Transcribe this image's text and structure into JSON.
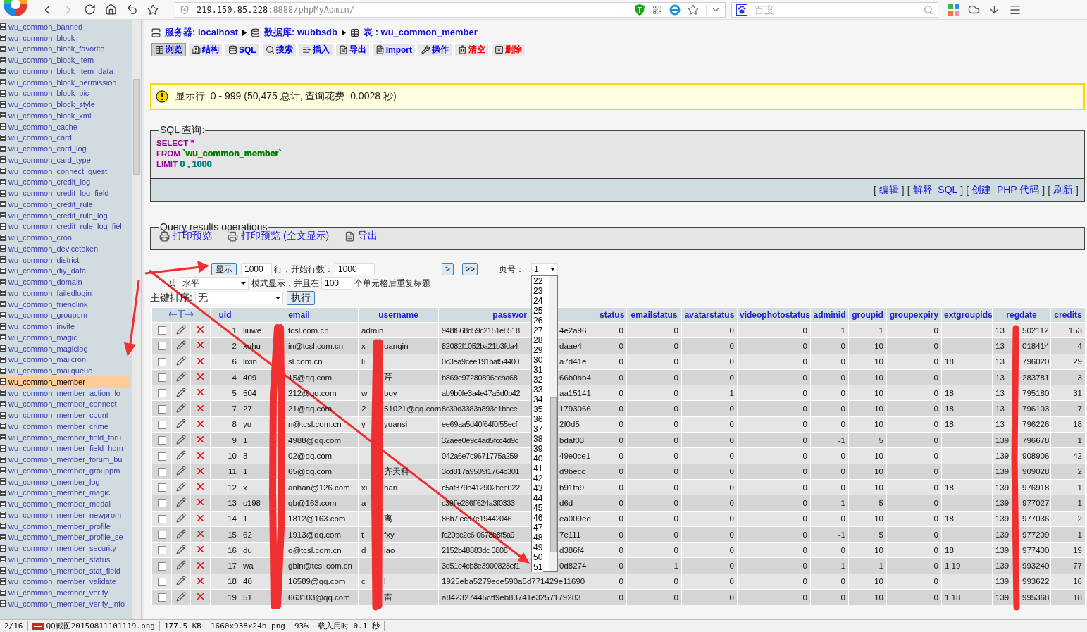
{
  "browser": {
    "address": {
      "host": "219.150.85.228",
      "rest": ":8888/phpMyAdmin/"
    },
    "search": {
      "placeholder": "百度"
    }
  },
  "sidebar": {
    "items": [
      {
        "label": "wu_common_banned",
        "selected": false
      },
      {
        "label": "wu_common_block",
        "selected": false
      },
      {
        "label": "wu_common_block_favorite",
        "selected": false
      },
      {
        "label": "wu_common_block_item",
        "selected": false
      },
      {
        "label": "wu_common_block_item_data",
        "selected": false
      },
      {
        "label": "wu_common_block_permission",
        "selected": false
      },
      {
        "label": "wu_common_block_pic",
        "selected": false
      },
      {
        "label": "wu_common_block_style",
        "selected": false
      },
      {
        "label": "wu_common_block_xml",
        "selected": false
      },
      {
        "label": "wu_common_cache",
        "selected": false
      },
      {
        "label": "wu_common_card",
        "selected": false
      },
      {
        "label": "wu_common_card_log",
        "selected": false
      },
      {
        "label": "wu_common_card_type",
        "selected": false
      },
      {
        "label": "wu_common_connect_guest",
        "selected": false
      },
      {
        "label": "wu_common_credit_log",
        "selected": false
      },
      {
        "label": "wu_common_credit_log_field",
        "selected": false
      },
      {
        "label": "wu_common_credit_rule",
        "selected": false
      },
      {
        "label": "wu_common_credit_rule_log",
        "selected": false
      },
      {
        "label": "wu_common_credit_rule_log_fiel",
        "selected": false
      },
      {
        "label": "wu_common_cron",
        "selected": false
      },
      {
        "label": "wu_common_devicetoken",
        "selected": false
      },
      {
        "label": "wu_common_district",
        "selected": false
      },
      {
        "label": "wu_common_diy_data",
        "selected": false
      },
      {
        "label": "wu_common_domain",
        "selected": false
      },
      {
        "label": "wu_common_failedlogin",
        "selected": false
      },
      {
        "label": "wu_common_friendlink",
        "selected": false
      },
      {
        "label": "wu_common_grouppm",
        "selected": false
      },
      {
        "label": "wu_common_invite",
        "selected": false
      },
      {
        "label": "wu_common_magic",
        "selected": false
      },
      {
        "label": "wu_common_magiclog",
        "selected": false
      },
      {
        "label": "wu_common_mailcron",
        "selected": false
      },
      {
        "label": "wu_common_mailqueue",
        "selected": false
      },
      {
        "label": "wu_common_member",
        "selected": true
      },
      {
        "label": "wu_common_member_action_lo",
        "selected": false
      },
      {
        "label": "wu_common_member_connect",
        "selected": false
      },
      {
        "label": "wu_common_member_count",
        "selected": false
      },
      {
        "label": "wu_common_member_crime",
        "selected": false
      },
      {
        "label": "wu_common_member_field_foru",
        "selected": false
      },
      {
        "label": "wu_common_member_field_hom",
        "selected": false
      },
      {
        "label": "wu_common_member_forum_bu",
        "selected": false
      },
      {
        "label": "wu_common_member_grouppm",
        "selected": false
      },
      {
        "label": "wu_common_member_log",
        "selected": false
      },
      {
        "label": "wu_common_member_magic",
        "selected": false
      },
      {
        "label": "wu_common_member_medal",
        "selected": false
      },
      {
        "label": "wu_common_member_newprom",
        "selected": false
      },
      {
        "label": "wu_common_member_profile",
        "selected": false
      },
      {
        "label": "wu_common_member_profile_se",
        "selected": false
      },
      {
        "label": "wu_common_member_security",
        "selected": false
      },
      {
        "label": "wu_common_member_status",
        "selected": false
      },
      {
        "label": "wu_common_member_stat_field",
        "selected": false
      },
      {
        "label": "wu_common_member_validate",
        "selected": false
      },
      {
        "label": "wu_common_member_verify",
        "selected": false
      },
      {
        "label": "wu_common_member_verify_info",
        "selected": false
      }
    ]
  },
  "breadcrumb": [
    {
      "label": "服务器: localhost"
    },
    {
      "label": "数据库: wubbsdb"
    },
    {
      "label": "表 : wu_common_member"
    }
  ],
  "tabs": [
    {
      "label": "浏览",
      "selected": true,
      "color": "#0000ee"
    },
    {
      "label": "结构",
      "selected": false,
      "color": "#0000ee"
    },
    {
      "label": "SQL",
      "selected": false,
      "color": "#0000ee"
    },
    {
      "label": "搜索",
      "selected": false,
      "color": "#0000ee"
    },
    {
      "label": "插入",
      "selected": false,
      "color": "#0000ee"
    },
    {
      "label": "导出",
      "selected": false,
      "color": "#0000ee"
    },
    {
      "label": "Import",
      "selected": false,
      "color": "#0000ee"
    },
    {
      "label": "操作",
      "selected": false,
      "color": "#0000ee"
    },
    {
      "label": "清空",
      "selected": false,
      "color": "#ee0000"
    },
    {
      "label": "删除",
      "selected": false,
      "color": "#ee0000"
    }
  ],
  "notice": "显示行  0 - 999 (50,475 总计, 查询花费  0.0028 秒)",
  "sql": {
    "legend": "SQL 查询:",
    "lines": [
      {
        "keyword": "SELECT",
        "rest": "*",
        "color": "#cc00cc"
      },
      {
        "keyword": "FROM",
        "rest": "`wu_common_member`",
        "color": "#008000"
      },
      {
        "keyword": "LIMIT",
        "rest": "0 , 1000",
        "color": "#008080"
      }
    ],
    "links": [
      {
        "open": "[",
        "label": "编辑",
        "close": "]"
      },
      {
        "open": "[",
        "label": "解释  SQL",
        "close": "]"
      },
      {
        "open": "[",
        "label": "创建  PHP 代码",
        "close": "]"
      },
      {
        "open": "[",
        "label": "刷新",
        "close": "]"
      }
    ]
  },
  "results_operations": {
    "legend": "Query results operations",
    "links": [
      {
        "label": "打印预览"
      },
      {
        "label": "打印预览 (全文显示)"
      },
      {
        "label": "导出"
      }
    ]
  },
  "controls": {
    "show_button": "显示",
    "rows_value": "1000",
    "rows_label": "行，开始行数：",
    "start_value": "1000",
    "next_button": ">",
    "last_button": ">>",
    "page_label": "页号：",
    "page_value": "1",
    "mode_prefix": "以",
    "mode_value": "水平",
    "mode_label": "模式显示，并且在",
    "repeat_value": "100",
    "repeat_label": "个单元格后重复标题",
    "sort_label": "主键排序:",
    "sort_value": "无",
    "go_button": "执行"
  },
  "page_options": [
    {
      "label": "22",
      "selected": false
    },
    {
      "label": "23",
      "selected": false
    },
    {
      "label": "24",
      "selected": false
    },
    {
      "label": "25",
      "selected": false
    },
    {
      "label": "26",
      "selected": false
    },
    {
      "label": "27",
      "selected": false
    },
    {
      "label": "28",
      "selected": false
    },
    {
      "label": "29",
      "selected": false
    },
    {
      "label": "30",
      "selected": false
    },
    {
      "label": "31",
      "selected": false
    },
    {
      "label": "32",
      "selected": false
    },
    {
      "label": "33",
      "selected": false
    },
    {
      "label": "34",
      "selected": false
    },
    {
      "label": "35",
      "selected": false
    },
    {
      "label": "36",
      "selected": false
    },
    {
      "label": "37",
      "selected": false
    },
    {
      "label": "38",
      "selected": false
    },
    {
      "label": "39",
      "selected": false
    },
    {
      "label": "40",
      "selected": false
    },
    {
      "label": "41",
      "selected": false
    },
    {
      "label": "42",
      "selected": false
    },
    {
      "label": "43",
      "selected": false
    },
    {
      "label": "44",
      "selected": false
    },
    {
      "label": "45",
      "selected": false
    },
    {
      "label": "46",
      "selected": false
    },
    {
      "label": "47",
      "selected": false
    },
    {
      "label": "48",
      "selected": false
    },
    {
      "label": "49",
      "selected": false
    },
    {
      "label": "50",
      "selected": false
    },
    {
      "label": "51",
      "selected": false
    }
  ],
  "table": {
    "columns": [
      {
        "label": "uid",
        "kind": "plain"
      },
      {
        "label": "email",
        "kind": "plain"
      },
      {
        "label": "username",
        "kind": "plain"
      },
      {
        "label": "passwor",
        "kind": "covered"
      },
      {
        "label": "status",
        "kind": "plain"
      },
      {
        "label": "emailstatus",
        "kind": "plain"
      },
      {
        "label": "avatarstatus",
        "kind": "plain"
      },
      {
        "label": "videophotostatus",
        "kind": "plain"
      },
      {
        "label": "adminid",
        "kind": "plain"
      },
      {
        "label": "groupid",
        "kind": "plain"
      },
      {
        "label": "groupexpiry",
        "kind": "plain"
      },
      {
        "label": "extgroupids",
        "kind": "plain"
      },
      {
        "label": "regdate",
        "kind": "plain"
      },
      {
        "label": "credits",
        "kind": "plain"
      }
    ],
    "rows": [
      {
        "checked": false,
        "uid": "1",
        "email": {
          "before": "liuwe",
          "after": "tcsl.com.cn"
        },
        "username": "admin",
        "password": {
          "before": "948f668d59c2151e8518",
          "after": "4e2a96"
        },
        "status": "0",
        "emailstatus": "0",
        "avatarstatus": "0",
        "videophotostatus": "0",
        "adminid": "1",
        "groupid": "1",
        "groupexpiry": "0",
        "regdate": {
          "before": "13",
          "after": "502112"
        },
        "credits": "153"
      },
      {
        "checked": false,
        "uid": "2",
        "email": {
          "before": "xuhu",
          "after": "in@tcsl.com.cn"
        },
        "username": {
          "before": "x",
          "after": "uanqin"
        },
        "password": {
          "before": "82082f1052ba21b3fda4",
          "after": "daae4"
        },
        "status": "0",
        "emailstatus": "0",
        "avatarstatus": "0",
        "videophotostatus": "0",
        "adminid": "0",
        "groupid": "10",
        "groupexpiry": "0",
        "regdate": {
          "before": "13",
          "after": "018414"
        },
        "credits": "4"
      },
      {
        "checked": false,
        "uid": "6",
        "email": {
          "before": "lixin",
          "after": "sl.com.cn"
        },
        "username": {
          "before": "li"
        },
        "password": {
          "before": "0c3ea9cee191baf54400",
          "after": "a7d41e"
        },
        "status": "0",
        "emailstatus": "0",
        "avatarstatus": "0",
        "videophotostatus": "0",
        "adminid": "0",
        "groupid": "10",
        "groupexpiry": "0",
        "extgroupids": "18",
        "regdate": {
          "before": "13",
          "after": "796020"
        },
        "credits": "29"
      },
      {
        "checked": false,
        "uid": "4",
        "email": {
          "before": "409",
          "after": "15@qq.com"
        },
        "username": {
          "after": "芹"
        },
        "password": {
          "before": "b869e97280896ccba68",
          "after": "66b0bb4"
        },
        "status": "0",
        "emailstatus": "0",
        "avatarstatus": "0",
        "videophotostatus": "0",
        "adminid": "0",
        "groupid": "10",
        "groupexpiry": "0",
        "regdate": {
          "before": "13",
          "after": "283781"
        },
        "credits": "3"
      },
      {
        "checked": false,
        "uid": "5",
        "email": {
          "before": "504",
          "after": "212@qq.com"
        },
        "username": {
          "before": "w",
          "after": "boy"
        },
        "password": {
          "before": "ab9b0fe3a4e47a5d0b42",
          "after": "aa15141"
        },
        "status": "0",
        "emailstatus": "0",
        "avatarstatus": "1",
        "videophotostatus": "0",
        "adminid": "0",
        "groupid": "10",
        "groupexpiry": "0",
        "extgroupids": "18",
        "regdate": {
          "before": "13",
          "after": "795180"
        },
        "credits": "31"
      },
      {
        "checked": false,
        "uid": "7",
        "email": {
          "before": "27",
          "after": "21@qq.com"
        },
        "username": {
          "before": "2",
          "after": "51021@qq.com"
        },
        "password": {
          "before": "8c39d3383a893e1bbce",
          "after": "1793066"
        },
        "status": "0",
        "emailstatus": "0",
        "avatarstatus": "0",
        "videophotostatus": "0",
        "adminid": "0",
        "groupid": "10",
        "groupexpiry": "0",
        "extgroupids": "18",
        "regdate": {
          "before": "13",
          "after": "796103"
        },
        "credits": "7"
      },
      {
        "checked": false,
        "uid": "8",
        "email": {
          "before": "yu",
          "after": "n@tcsl.com.cn"
        },
        "username": {
          "before": "y",
          "after": "yuansi"
        },
        "password": {
          "before": "ee69aa5d40f64f0f55ecf",
          "after": "2f0d5"
        },
        "status": "0",
        "emailstatus": "0",
        "avatarstatus": "0",
        "videophotostatus": "0",
        "adminid": "0",
        "groupid": "10",
        "groupexpiry": "0",
        "extgroupids": "18",
        "regdate": {
          "before": "13",
          "after": "796226"
        },
        "credits": "18"
      },
      {
        "checked": false,
        "uid": "9",
        "email": {
          "before": "1",
          "after": "4988@qq.com"
        },
        "password": {
          "before": "32aee0e9c4ad5fcc4d9c",
          "after": "bdaf03"
        },
        "status": "0",
        "emailstatus": "0",
        "avatarstatus": "0",
        "videophotostatus": "0",
        "adminid": "-1",
        "groupid": "5",
        "groupexpiry": "0",
        "regdate": {
          "before": "139",
          "after": "796678"
        },
        "credits": "1"
      },
      {
        "checked": false,
        "uid": "10",
        "email": {
          "before": "3",
          "after": "02@qq.com"
        },
        "password": {
          "before": "042a6e7c9671775a259",
          "after": "49e0ce1"
        },
        "status": "0",
        "emailstatus": "0",
        "avatarstatus": "0",
        "videophotostatus": "0",
        "adminid": "0",
        "groupid": "10",
        "groupexpiry": "0",
        "regdate": {
          "before": "139",
          "after": "908906"
        },
        "credits": "42"
      },
      {
        "checked": false,
        "uid": "11",
        "email": {
          "before": "1",
          "after": "65@qq.com"
        },
        "username": {
          "after": "齐天科"
        },
        "password": {
          "before": "3cd817a9509f1764c301",
          "after": "d9becc"
        },
        "status": "0",
        "emailstatus": "0",
        "avatarstatus": "0",
        "videophotostatus": "0",
        "adminid": "0",
        "groupid": "10",
        "groupexpiry": "0",
        "regdate": {
          "before": "139",
          "after": "909028"
        },
        "credits": "2"
      },
      {
        "checked": false,
        "uid": "12",
        "email": {
          "before": "x",
          "after": "anhan@126.com"
        },
        "username": {
          "before": "xi",
          "after": "han"
        },
        "password": {
          "before": "c5af379e412902bee022",
          "after": "b91fa9"
        },
        "status": "0",
        "emailstatus": "0",
        "avatarstatus": "0",
        "videophotostatus": "0",
        "adminid": "0",
        "groupid": "10",
        "groupexpiry": "0",
        "extgroupids": "18",
        "regdate": {
          "before": "139",
          "after": "976918"
        },
        "credits": "1"
      },
      {
        "checked": false,
        "uid": "13",
        "email": {
          "before": "c198",
          "after": "qb@163.com"
        },
        "username": {
          "before": "a"
        },
        "password": {
          "before": "c39ffe286ff624a3f0333",
          "after": "d6d"
        },
        "status": "0",
        "emailstatus": "0",
        "avatarstatus": "0",
        "videophotostatus": "0",
        "adminid": "-1",
        "groupid": "5",
        "groupexpiry": "0",
        "regdate": {
          "before": "139",
          "after": "977027"
        },
        "credits": "1"
      },
      {
        "checked": false,
        "uid": "14",
        "email": {
          "before": "1",
          "after": "1812@163.com"
        },
        "username": {
          "after": "离"
        },
        "password": {
          "before": "86b7 ecd7e19442046",
          "after": "ea009ed"
        },
        "status": "0",
        "emailstatus": "0",
        "avatarstatus": "0",
        "videophotostatus": "0",
        "adminid": "0",
        "groupid": "10",
        "groupexpiry": "0",
        "extgroupids": "18",
        "regdate": {
          "before": "139",
          "after": "977036"
        },
        "credits": "2"
      },
      {
        "checked": false,
        "uid": "15",
        "email": {
          "before": "62",
          "after": "1913@qq.com"
        },
        "username": {
          "before": "t",
          "after": "fxy"
        },
        "password": {
          "before": "fc20bc2c6 0678b8f5a9",
          "after": "7e111"
        },
        "status": "0",
        "emailstatus": "0",
        "avatarstatus": "0",
        "videophotostatus": "0",
        "adminid": "-1",
        "groupid": "5",
        "groupexpiry": "0",
        "regdate": {
          "before": "139",
          "after": "977209"
        },
        "credits": "1"
      },
      {
        "checked": false,
        "uid": "16",
        "email": {
          "before": "du",
          "after": "o@tcsl.com.cn"
        },
        "username": {
          "before": "d",
          "after": "iao"
        },
        "password": {
          "before": "2152b48883dc 3808",
          "after": "d386f4"
        },
        "status": "0",
        "emailstatus": "0",
        "avatarstatus": "0",
        "videophotostatus": "0",
        "adminid": "0",
        "groupid": "10",
        "groupexpiry": "0",
        "extgroupids": "18",
        "regdate": {
          "before": "139",
          "after": "977400"
        },
        "credits": "19"
      },
      {
        "checked": false,
        "uid": "17",
        "email": {
          "before": "wa",
          "after": "gbin@tcsl.com.cn"
        },
        "password": {
          "before": "3d51e4cb8e3900828ef1",
          "after": "0d8274"
        },
        "status": "0",
        "emailstatus": "1",
        "avatarstatus": "0",
        "videophotostatus": "0",
        "adminid": "1",
        "groupid": "1",
        "groupexpiry": "0",
        "extgroupids": "1   19",
        "regdate": {
          "before": "139",
          "after": "993240"
        },
        "credits": "77"
      },
      {
        "checked": false,
        "uid": "18",
        "email": {
          "before": "40",
          "after": "16589@qq.com"
        },
        "username": {
          "before": "c",
          "after": "l"
        },
        "password": "1925eba5279ece590a5d771429e11690",
        "status": "0",
        "emailstatus": "0",
        "avatarstatus": "0",
        "videophotostatus": "0",
        "adminid": "0",
        "groupid": "10",
        "groupexpiry": "0",
        "regdate": {
          "before": "139",
          "after": "993622"
        },
        "credits": "16"
      },
      {
        "checked": false,
        "uid": "19",
        "email": {
          "before": "51",
          "after": "663103@qq.com"
        },
        "username": {
          "after": "雷"
        },
        "password": "a842327445cff9eb83741e3257179283",
        "status": "0",
        "emailstatus": "0",
        "avatarstatus": "0",
        "videophotostatus": "0",
        "adminid": "0",
        "groupid": "10",
        "groupexpiry": "0",
        "extgroupids": "1   18",
        "regdate": {
          "before": "139",
          "after": "995368"
        },
        "credits": "18"
      }
    ]
  },
  "status_bar": {
    "items": [
      {
        "text": "2/16",
        "kind": "text"
      },
      {
        "text": "QQ截图20150811101119.png",
        "kind": "file"
      },
      {
        "text": "177.5 KB",
        "kind": "text"
      },
      {
        "text": "1660x938x24b png",
        "kind": "text"
      },
      {
        "text": "93%",
        "kind": "text"
      },
      {
        "text": "载入用时 0.1 秒",
        "kind": "text"
      }
    ]
  }
}
